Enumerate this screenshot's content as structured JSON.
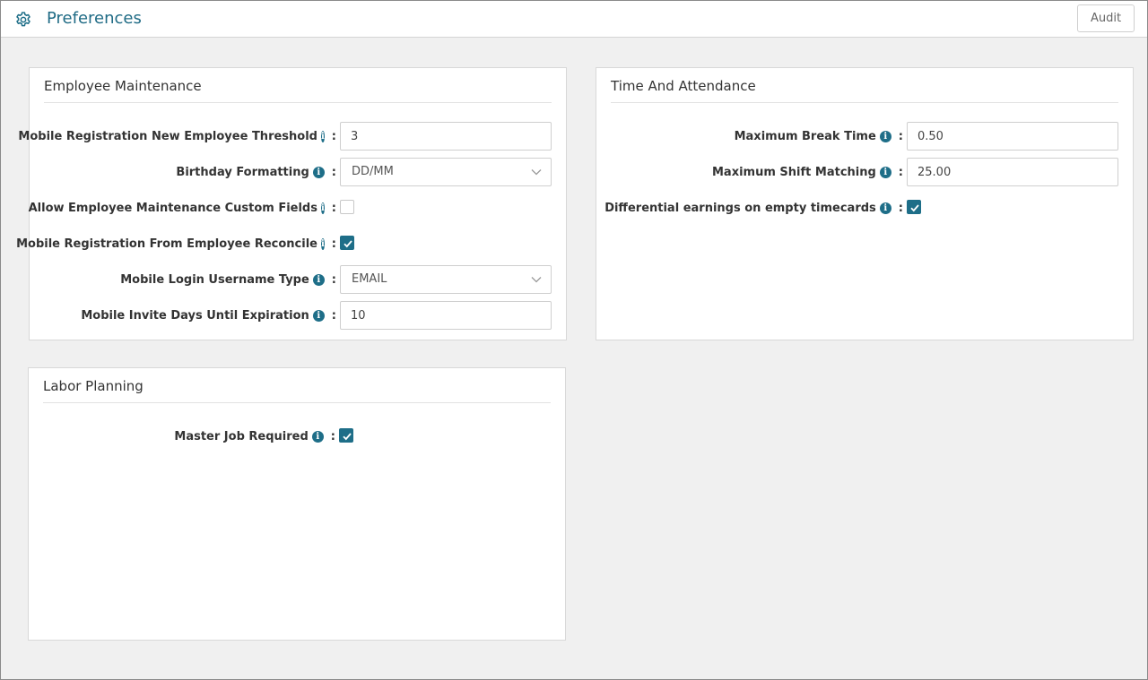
{
  "header": {
    "title": "Preferences",
    "audit_label": "Audit",
    "icon": "gear-icon"
  },
  "employee_maintenance": {
    "title": "Employee Maintenance",
    "rows": [
      {
        "label": "Mobile Registration New Employee Threshold",
        "type": "input",
        "value": "3"
      },
      {
        "label": "Birthday Formatting",
        "type": "select",
        "value": "DD/MM"
      },
      {
        "label": "Allow Employee Maintenance Custom Fields",
        "type": "checkbox",
        "checked": false
      },
      {
        "label": "Mobile Registration From Employee Reconcile",
        "type": "checkbox",
        "checked": true
      },
      {
        "label": "Mobile Login Username Type",
        "type": "select",
        "value": "EMAIL"
      },
      {
        "label": "Mobile Invite Days Until Expiration",
        "type": "input",
        "value": "10"
      }
    ]
  },
  "time_and_attendance": {
    "title": "Time And Attendance",
    "rows": [
      {
        "label": "Maximum Break Time",
        "type": "input",
        "value": "0.50"
      },
      {
        "label": "Maximum Shift Matching",
        "type": "input",
        "value": "25.00"
      },
      {
        "label": "Differential earnings on empty timecards",
        "type": "checkbox",
        "checked": true
      }
    ]
  },
  "labor_planning": {
    "title": "Labor Planning",
    "rows": [
      {
        "label": "Master Job Required",
        "type": "checkbox",
        "checked": true
      }
    ]
  },
  "colors": {
    "accent": "#1e6e88",
    "title_text": "#1f6b85",
    "background": "#f0f0f0"
  },
  "info_glyph": "i",
  "colon": ":"
}
